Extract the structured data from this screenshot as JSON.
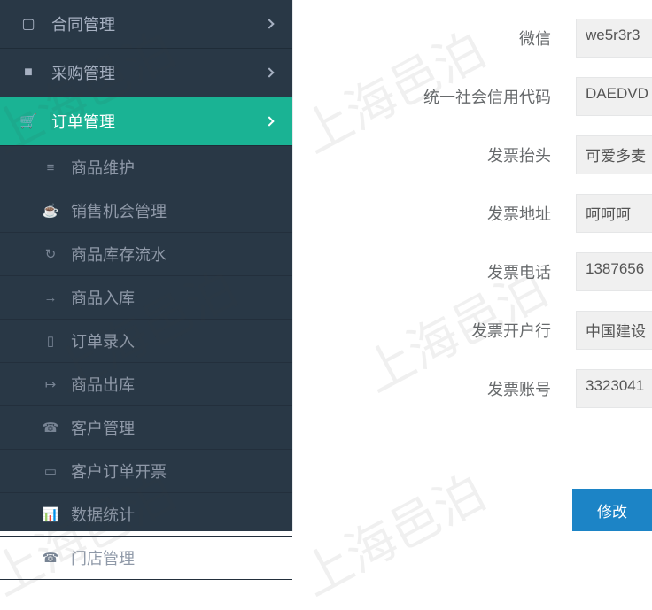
{
  "sidebar": {
    "top": [
      {
        "icon": "▢",
        "label": "合同管理"
      },
      {
        "icon": "■",
        "label": "采购管理"
      },
      {
        "icon": "🛒",
        "label": "订单管理"
      }
    ],
    "sub": [
      {
        "icon": "≡",
        "label": "商品维护"
      },
      {
        "icon": "☕",
        "label": "销售机会管理"
      },
      {
        "icon": "↻",
        "label": "商品库存流水"
      },
      {
        "icon": "→",
        "label": "商品入库"
      },
      {
        "icon": "▯",
        "label": "订单录入"
      },
      {
        "icon": "↦",
        "label": "商品出库"
      },
      {
        "icon": "☎",
        "label": "客户管理"
      },
      {
        "icon": "▭",
        "label": "客户订单开票"
      },
      {
        "icon": "📊",
        "label": "数据统计"
      },
      {
        "icon": "☎",
        "label": "门店管理"
      }
    ]
  },
  "form": {
    "fields": [
      {
        "label": "微信",
        "value": "we5r3r3"
      },
      {
        "label": "统一社会信用代码",
        "value": "DAEDVD"
      },
      {
        "label": "发票抬头",
        "value": "可爱多麦"
      },
      {
        "label": "发票地址",
        "value": "呵呵呵"
      },
      {
        "label": "发票电话",
        "value": "1387656"
      },
      {
        "label": "发票开户行",
        "value": "中国建设"
      },
      {
        "label": "发票账号",
        "value": "3323041"
      }
    ]
  },
  "footer": {
    "modify": "修改"
  },
  "watermark": "上海邑泊"
}
